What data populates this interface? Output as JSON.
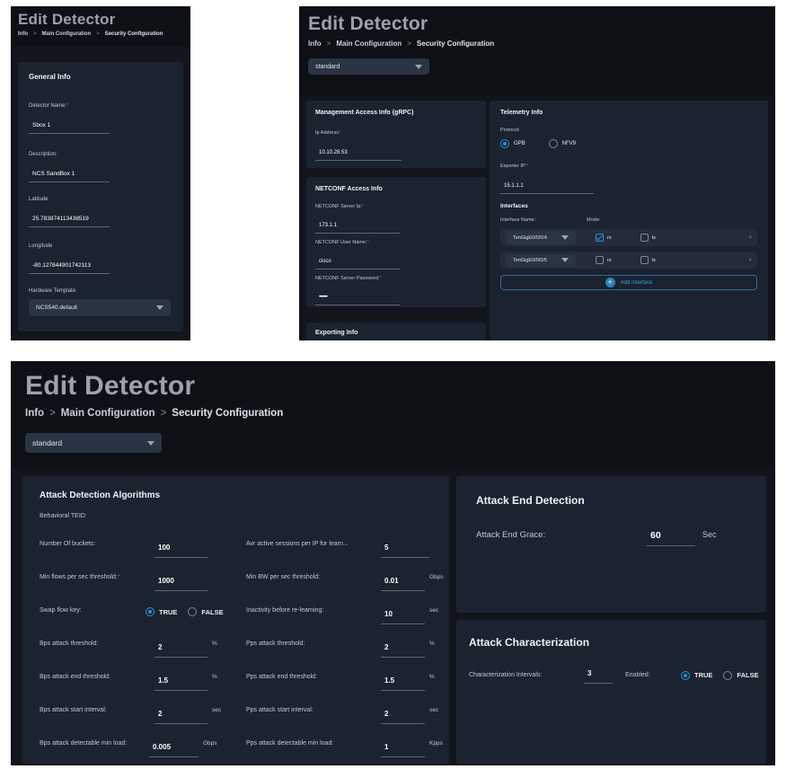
{
  "app": {
    "title": "Edit Detector",
    "breadcrumb": [
      "Info",
      "Main Configuration",
      "Security Configuration"
    ],
    "breadcrumb_separator": ">",
    "profile_select": "standard"
  },
  "colors": {
    "page_bg": "#ffffff",
    "panel_bg": "#12151c",
    "header_bg": "#0d1015",
    "card_bg": "#1b2230",
    "accent": "#2196d6",
    "required": "#e0443e",
    "title_text": "#9aa2ad"
  },
  "panel_info": {
    "card_title": "General Info",
    "fields": [
      {
        "label": "Detector Name:",
        "required": true,
        "value": "Sbox 1"
      },
      {
        "label": "Description:",
        "required": false,
        "value": "NCS SandBox 1"
      },
      {
        "label": "Latitude",
        "required": false,
        "value": "25.783874113438519"
      },
      {
        "label": "Longitude",
        "required": false,
        "value": "-80.127844901742113"
      }
    ],
    "hardware_template_label": "Hardware Template:",
    "hardware_template_value": "NCS540.default"
  },
  "panel_main": {
    "management": {
      "card_title": "Management Access Info (gRPC)",
      "ip_label": "Ip Address",
      "ip_required": true,
      "ip_value": "10.10.28.53"
    },
    "netconf": {
      "card_title": "NETCONF Access Info",
      "fields": [
        {
          "label": "NETCONF Server Ip:",
          "required": true,
          "value": "173.1.1"
        },
        {
          "label": "NETCONF User Name:",
          "required": true,
          "value": "cisco"
        },
        {
          "label": "NETCONF Server Password:",
          "required": true,
          "value": "••••••••"
        }
      ]
    },
    "exporting": {
      "card_title": "Exporting Info"
    },
    "telemetry": {
      "card_title": "Telemetry Info",
      "protocol_label": "Protocol:",
      "protocol_options": [
        {
          "label": "GPB",
          "selected": true
        },
        {
          "label": "NFV9",
          "selected": false
        }
      ],
      "exporter_ip_label": "Exporter IP:",
      "exporter_ip_required": true,
      "exporter_ip_value": "15.1.1.1",
      "interfaces_title": "Interfaces",
      "col_interface_name": "Interface Name:",
      "col_mode": "Mode:",
      "rows": [
        {
          "name": "TenGigE0/0/0/4",
          "rx": true,
          "tx": false,
          "remove": "×"
        },
        {
          "name": "TenGigE0/0/0/5",
          "rx": false,
          "tx": false,
          "remove": "×"
        }
      ],
      "mode_rx_label": "rx",
      "mode_tx_label": "tx",
      "add_interface_label": "Add Interface",
      "add_icon": "plus-circle-icon"
    }
  },
  "panel_security": {
    "algorithms": {
      "card_title": "Attack Detection Algorithms",
      "subsection": "Behavioral TEID:",
      "left_rows": [
        {
          "label": "Number Of buckets:",
          "value": "100",
          "unit": ""
        },
        {
          "label": "Min flows per sec threshold:",
          "value": "1000",
          "unit": "",
          "required": true
        },
        {
          "label": "Swap flow key:",
          "type": "radio",
          "options": [
            {
              "label": "TRUE",
              "selected": true
            },
            {
              "label": "FALSE",
              "selected": false
            }
          ]
        },
        {
          "label": "Bps attack threshold:",
          "value": "2",
          "unit": "%"
        },
        {
          "label": "Bps attack end threshold:",
          "value": "1.5",
          "unit": "%"
        },
        {
          "label": "Bps attack start interval:",
          "value": "2",
          "unit": "sec"
        },
        {
          "label": "Bps attack detectable min load:",
          "value": "0.005",
          "unit": "Gbps"
        }
      ],
      "right_rows": [
        {
          "label": "Avr active sessions per IP for learn...",
          "value": "5",
          "unit": ""
        },
        {
          "label": "Min BW per sec threshold:",
          "value": "0.01",
          "unit": "Gbps"
        },
        {
          "label": "Inactivity before re-learning:",
          "value": "10",
          "unit": "sec"
        },
        {
          "label": "Pps attack threshold:",
          "value": "2",
          "unit": "%"
        },
        {
          "label": "Pps attack end threshold:",
          "value": "1.5",
          "unit": "%"
        },
        {
          "label": "Pps attack start interval:",
          "value": "2",
          "unit": "sec"
        },
        {
          "label": "Pps attack detectable min load:",
          "value": "1",
          "unit": "Kpps"
        }
      ]
    },
    "attack_end": {
      "card_title": "Attack End Detection",
      "grace_label": "Attack End Grace:",
      "grace_value": "60",
      "grace_unit": "Sec"
    },
    "characterization": {
      "card_title": "Attack Characterization",
      "intervals_label": "Characterization Intervals:",
      "intervals_value": "3",
      "enabled_label": "Enabled:",
      "enabled_options": [
        {
          "label": "TRUE",
          "selected": true
        },
        {
          "label": "FALSE",
          "selected": false
        }
      ]
    }
  }
}
